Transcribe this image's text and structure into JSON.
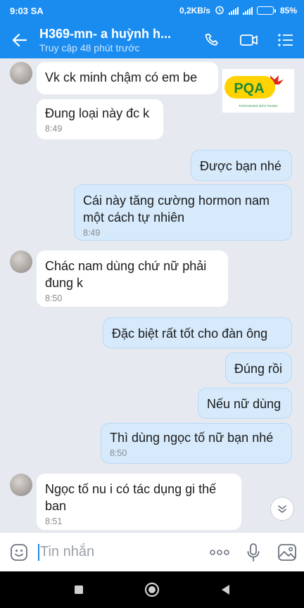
{
  "status_bar": {
    "time": "9:03 SA",
    "net_speed": "0,2KB/s",
    "battery_pct": "85%",
    "battery_level": 0.85
  },
  "header": {
    "title": "H369-mn- a huỳnh h...",
    "subtitle": "Truy cập 48 phút trước",
    "accent": "#1a8cf0"
  },
  "logo": {
    "text": "PQA",
    "tagline": "THẢO DƯỢC BẢO THANH"
  },
  "messages": [
    {
      "dir": "in",
      "text": "Vk ck minh chậm có em be",
      "time": ""
    },
    {
      "dir": "in",
      "text": "Đung loại này đc k",
      "time": "8:49"
    },
    {
      "dir": "out",
      "text": "Được bạn nhé",
      "time": ""
    },
    {
      "dir": "out",
      "line1": "Cái này tăng cường hormon nam",
      "line2": "một cách tự nhiên",
      "time": "8:49"
    },
    {
      "dir": "in",
      "line1": "Chác nam dùng chứ nữ phải",
      "line2": "đung k",
      "time": "8:50"
    },
    {
      "dir": "out",
      "text": "Đặc biệt rất tốt cho đàn ông",
      "time": ""
    },
    {
      "dir": "out",
      "text": "Đúng rồi",
      "time": ""
    },
    {
      "dir": "out",
      "text": "Nếu nữ dùng",
      "time": ""
    },
    {
      "dir": "out",
      "text": "Thì dùng ngọc tố nữ bạn nhé",
      "time": "8:50"
    },
    {
      "dir": "in",
      "line1": "Ngọc tố nu i có tác dụng gi thế",
      "line2": "ban",
      "time": "8:51"
    }
  ],
  "input": {
    "placeholder": "Tin nhắn"
  },
  "icons": {
    "back": "arrow-left-icon",
    "call": "phone-icon",
    "video": "video-camera-icon",
    "menu": "list-menu-icon",
    "emoji": "emoji-icon",
    "more": "more-dots-icon",
    "mic": "microphone-icon",
    "image": "image-icon",
    "scroll": "chevron-down-icon"
  }
}
